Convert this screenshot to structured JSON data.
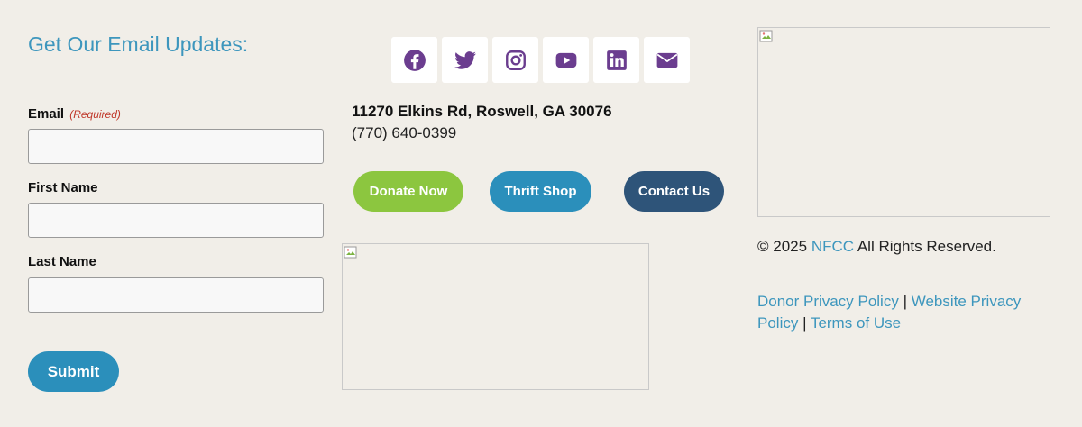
{
  "newsletter": {
    "title": "Get Our Email Updates:",
    "email_label": "Email",
    "required_label": "(Required)",
    "first_name_label": "First Name",
    "last_name_label": "Last Name",
    "submit_label": "Submit"
  },
  "social": {
    "icons": [
      "facebook-icon",
      "twitter-icon",
      "instagram-icon",
      "youtube-icon",
      "linkedin-icon",
      "envelope-icon"
    ],
    "icon_color": "#6b3d8f"
  },
  "contact": {
    "address": "11270 Elkins Rd, Roswell, GA 30076",
    "phone": "(770) 640-0399"
  },
  "buttons": {
    "donate": "Donate Now",
    "thrift": "Thrift Shop",
    "contact": "Contact Us"
  },
  "colors": {
    "background": "#f1eee8",
    "link": "#3d96bd",
    "donate": "#8cc63f",
    "thrift": "#2b8fbb",
    "contact": "#2e5479"
  },
  "footer": {
    "copyright_prefix": "© 2025",
    "org_link": "NFCC",
    "copyright_suffix": "All Rights Reserved.",
    "donor_privacy": "Donor Privacy Policy",
    "website_privacy": "Website Privacy Policy",
    "terms": "Terms of Use",
    "separator": "|"
  }
}
